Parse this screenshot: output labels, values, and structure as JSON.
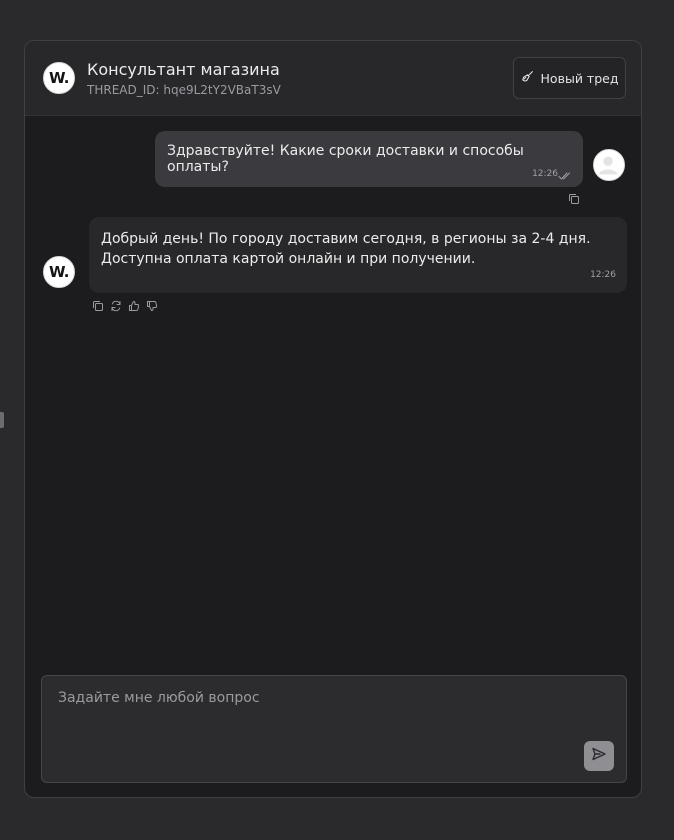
{
  "header": {
    "logo_text": "W.",
    "title": "Консультант магазина",
    "thread_id": "THREAD_ID: hqe9L2tY2VBaT3sV",
    "new_thread_label": "Новый тред"
  },
  "messages": [
    {
      "role": "user",
      "text": "Здравствуйте! Какие сроки доставки и способы оплаты?",
      "time": "12:26",
      "status_icon": "double-check-icon"
    },
    {
      "role": "assistant",
      "avatar_text": "W.",
      "text": "Добрый день! По городу доставим сегодня, в регионы за 2-4 дня. Доступна оплата картой онлайн и при получении.",
      "time": "12:26",
      "actions": [
        "copy-icon",
        "refresh-icon",
        "thumbs-up-icon",
        "thumbs-down-icon"
      ]
    }
  ],
  "composer": {
    "placeholder": "Задайте мне любой вопрос",
    "value": "",
    "send_icon": "send-icon"
  },
  "colors": {
    "page_background": "#2a2a2d",
    "chat_background": "#1c1c1e",
    "user_bubble": "#3a3a3f",
    "bot_bubble": "#28282b",
    "send_button": "#8e8e93"
  }
}
